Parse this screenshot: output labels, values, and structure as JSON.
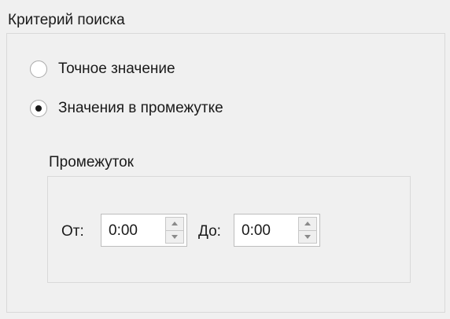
{
  "search_criteria": {
    "title": "Критерий поиска",
    "options": [
      {
        "label": "Точное значение",
        "checked": false
      },
      {
        "label": "Значения в промежутке",
        "checked": true
      }
    ]
  },
  "range": {
    "title": "Промежуток",
    "from_label": "От:",
    "from_value": "0:00",
    "to_label": "До:",
    "to_value": "0:00"
  },
  "icons": {
    "spin_up": "chevron-up-icon",
    "spin_down": "chevron-down-icon"
  },
  "colors": {
    "background": "#f0f0f0",
    "border": "#d9d9d9",
    "text": "#1a1a1a"
  }
}
